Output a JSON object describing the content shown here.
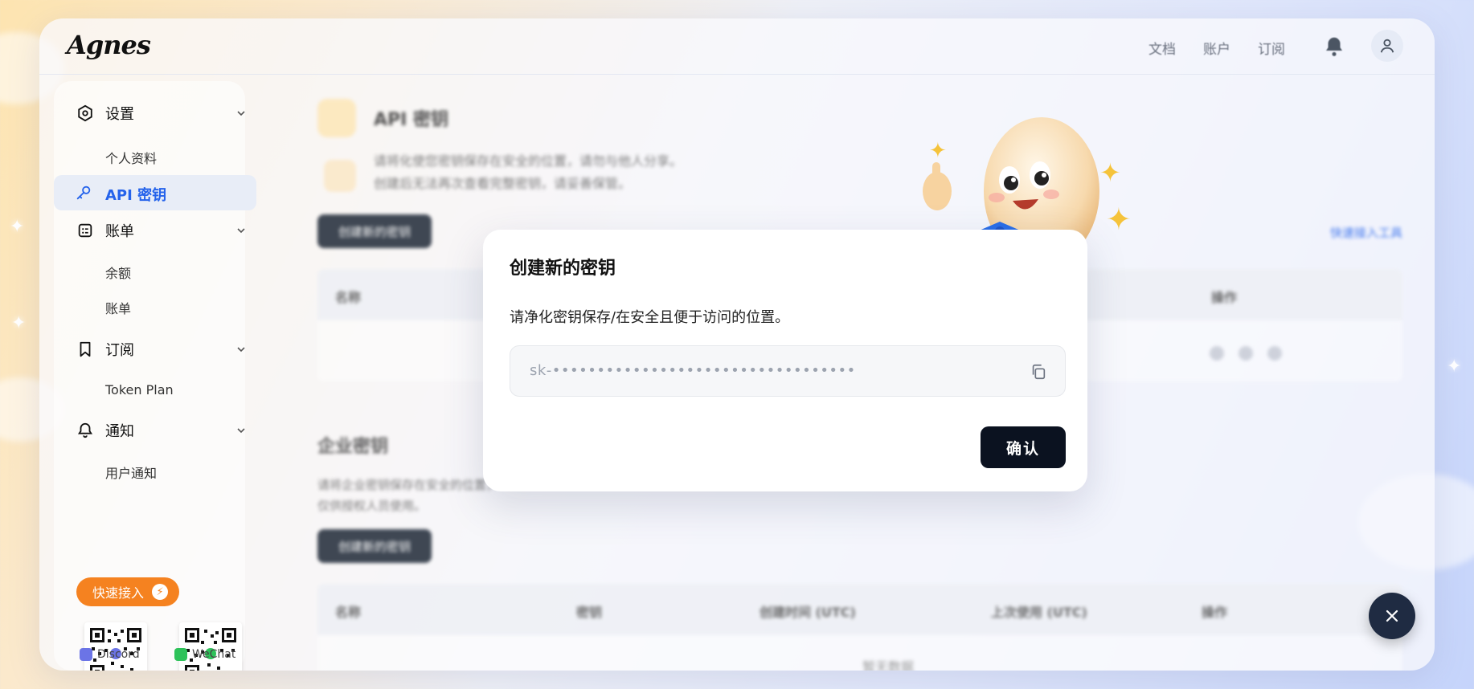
{
  "app": {
    "logo": "Agnes",
    "top_nav": [
      "文档",
      "账户",
      "订阅"
    ],
    "icons": {
      "notifications": "bell-icon",
      "user": "user-icon"
    }
  },
  "sidebar": {
    "groups": [
      {
        "label": "设置",
        "icon": "gear-hex-icon",
        "items": [
          "个人资料"
        ]
      },
      {
        "label": "账单",
        "icon": "bill-icon",
        "items": [
          "余额",
          "账单"
        ]
      },
      {
        "label": "订阅",
        "icon": "bookmark-icon",
        "items": [
          "Token Plan"
        ]
      },
      {
        "label": "通知",
        "icon": "bell-icon",
        "items": [
          "用户通知"
        ]
      }
    ],
    "active_item": "API 密钥",
    "quick_access": "快速接入",
    "qr": [
      {
        "label": "Discord",
        "color": "#6b74e6"
      },
      {
        "label": "WeChat",
        "color": "#2ec25a"
      }
    ]
  },
  "content": {
    "title": "API 密钥",
    "description": [
      "请将化使您密钥保存在安全的位置，请勿与他人分享。",
      "创建后无法再次查看完整密钥，请妥善保管。"
    ],
    "create_button": "创建新的密钥",
    "quick_link": "快速接入工具",
    "table1_headers": [
      "名称",
      "操作"
    ],
    "enterprise": {
      "title": "企业密钥",
      "description": [
        "请将企业密钥保存在安全的位置，",
        "仅供授权人员使用。"
      ],
      "create_button": "创建新的密钥",
      "headers": [
        "名称",
        "密钥",
        "创建时间 (UTC)",
        "上次使用 (UTC)",
        "操作"
      ],
      "empty": "暂无数据"
    }
  },
  "modal": {
    "title": "创建新的密钥",
    "hint": "请净化密钥保存/在安全且便于访问的位置。",
    "key_value": "sk-••••••••••••••••••••••••••••••••••",
    "confirm_label": "确认",
    "copy_icon": "copy-icon"
  },
  "colors": {
    "accent": "#2563eb",
    "orange": "#f58220",
    "dark": "#0b1220"
  }
}
